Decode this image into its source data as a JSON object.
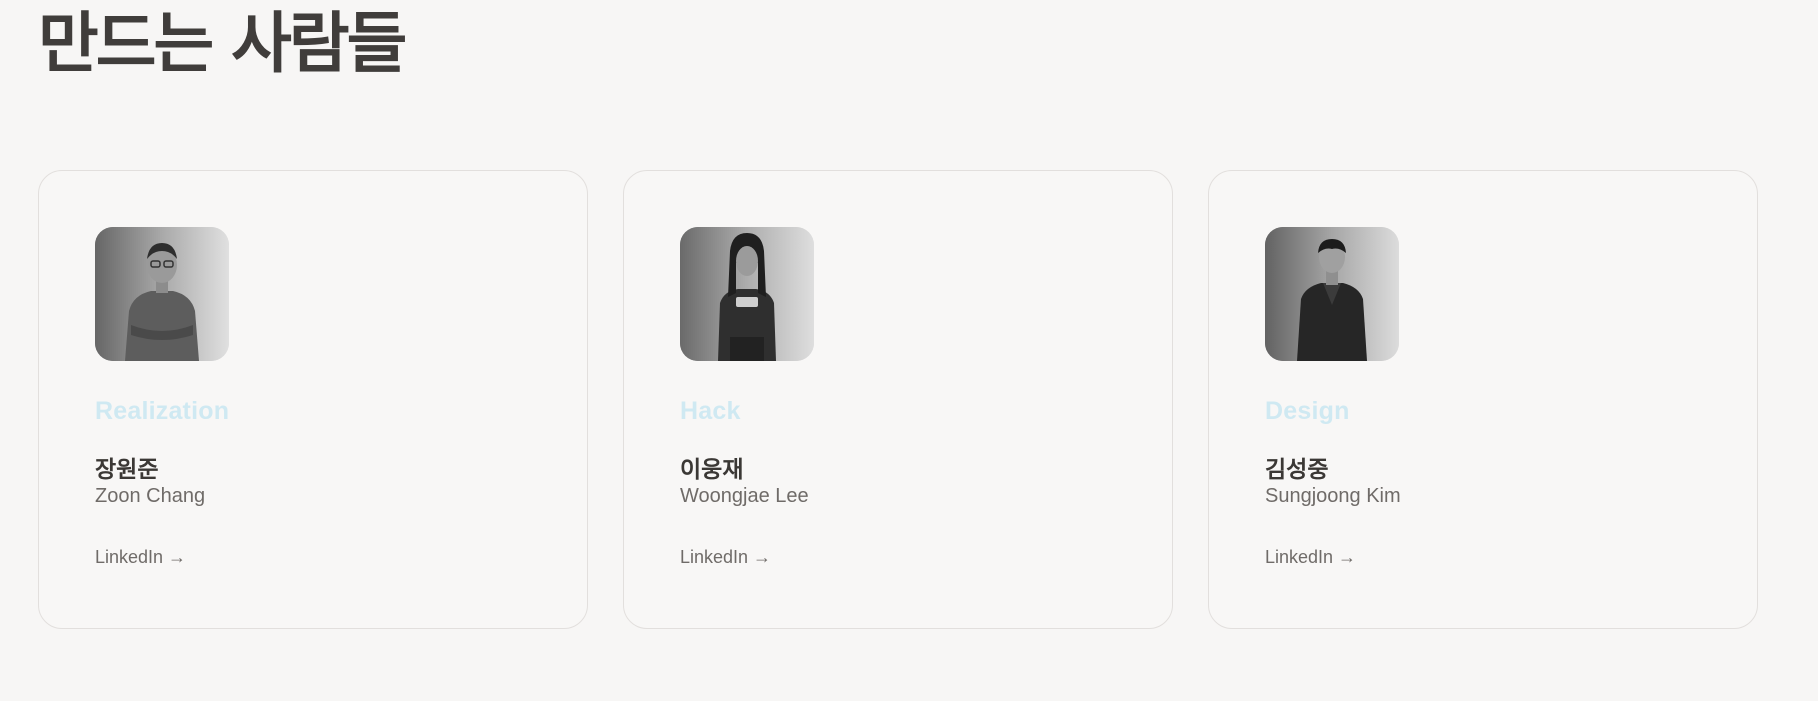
{
  "page": {
    "title": "만드는 사람들"
  },
  "members": [
    {
      "role": "Realization",
      "name_ko": "장원준",
      "name_en": "Zoon Chang",
      "link_label": "LinkedIn →"
    },
    {
      "role": "Hack",
      "name_ko": "이웅재",
      "name_en": "Woongjae Lee",
      "link_label": "LinkedIn →"
    },
    {
      "role": "Design",
      "name_ko": "김성중",
      "name_en": "Sungjoong Kim",
      "link_label": "LinkedIn →"
    }
  ],
  "colors": {
    "background": "#f7f6f5",
    "role_accent": "#cfe9f2",
    "heading": "#403d3b",
    "secondary_text": "#6f6b68",
    "card_border": "#e2dfdd"
  }
}
